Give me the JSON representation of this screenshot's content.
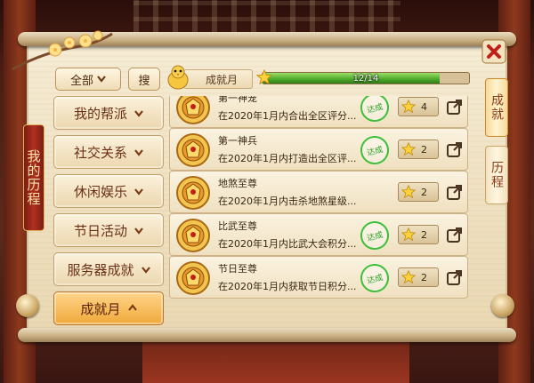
{
  "left_tab": "我的历程",
  "toolbar": {
    "filter_label": "全部",
    "search_label": "搜",
    "category_label": "成就月"
  },
  "progress": {
    "text": "12/14",
    "current": 12,
    "total": 14
  },
  "menu": [
    {
      "label": "我的帮派",
      "active": false
    },
    {
      "label": "社交关系",
      "active": false
    },
    {
      "label": "休闲娱乐",
      "active": false
    },
    {
      "label": "节日活动",
      "active": false
    },
    {
      "label": "服务器成就",
      "active": false
    },
    {
      "label": "成就月",
      "active": true
    }
  ],
  "achievements": [
    {
      "title": "第一神宠",
      "desc": "在2020年1月内合出全区评分...",
      "stamp": "达成",
      "reward": "4"
    },
    {
      "title": "第一神兵",
      "desc": "在2020年1月内打造出全区评...",
      "stamp": "达成",
      "reward": "2"
    },
    {
      "title": "地煞至尊",
      "desc": "在2020年1月内击杀地煞星级...",
      "stamp": "",
      "reward": "2"
    },
    {
      "title": "比武至尊",
      "desc": "在2020年1月内比武大会积分...",
      "stamp": "达成",
      "reward": "2"
    },
    {
      "title": "节日至尊",
      "desc": "在2020年1月内获取节日积分...",
      "stamp": "达成",
      "reward": "2"
    }
  ],
  "right_tabs": [
    {
      "label": "成就",
      "active": true
    },
    {
      "label": "历程",
      "active": false
    }
  ],
  "icons": {
    "close": "close-icon",
    "share": "share-icon",
    "star": "star-icon",
    "chevron": "chevron-down-icon",
    "chevron_up": "chevron-up-icon"
  },
  "colors": {
    "accent_red": "#b0301f",
    "progress_green": "#4ca82a",
    "stamp_green": "#2aa02a"
  }
}
